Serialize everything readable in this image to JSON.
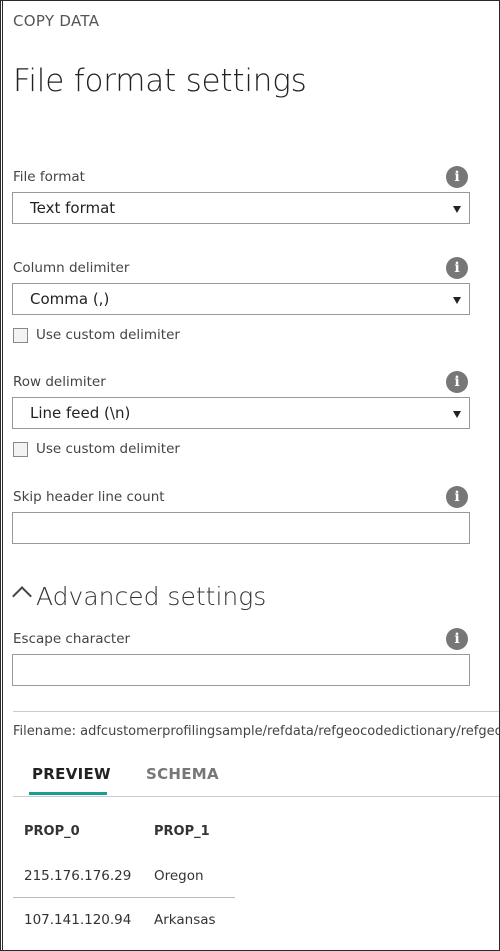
{
  "header": {
    "breadcrumb": "COPY DATA",
    "title": "File format settings"
  },
  "fields": {
    "file_format": {
      "label": "File format",
      "value": "Text format"
    },
    "column_delimiter": {
      "label": "Column delimiter",
      "value": "Comma (,)",
      "custom_label": "Use custom delimiter",
      "custom_checked": false
    },
    "row_delimiter": {
      "label": "Row delimiter",
      "value": "Line feed (\\n)",
      "custom_label": "Use custom delimiter",
      "custom_checked": false
    },
    "skip_header": {
      "label": "Skip header line count",
      "value": ""
    }
  },
  "advanced": {
    "title": "Advanced settings",
    "escape_character": {
      "label": "Escape character",
      "value": ""
    }
  },
  "info_glyph": "i",
  "filename": "Filename: adfcustomerprofilingsample/refdata/refgeocodedictionary/refgeocodedictionary.csv",
  "tabs": [
    {
      "label": "PREVIEW",
      "active": true
    },
    {
      "label": "SCHEMA",
      "active": false
    }
  ],
  "preview": {
    "columns": [
      "PROP_0",
      "PROP_1"
    ],
    "rows": [
      [
        "215.176.176.29",
        "Oregon"
      ],
      [
        "107.141.120.94",
        "Arkansas"
      ]
    ]
  },
  "colors": {
    "accent": "#1a9c8e",
    "info_icon": "#777777",
    "border": "#999999"
  }
}
